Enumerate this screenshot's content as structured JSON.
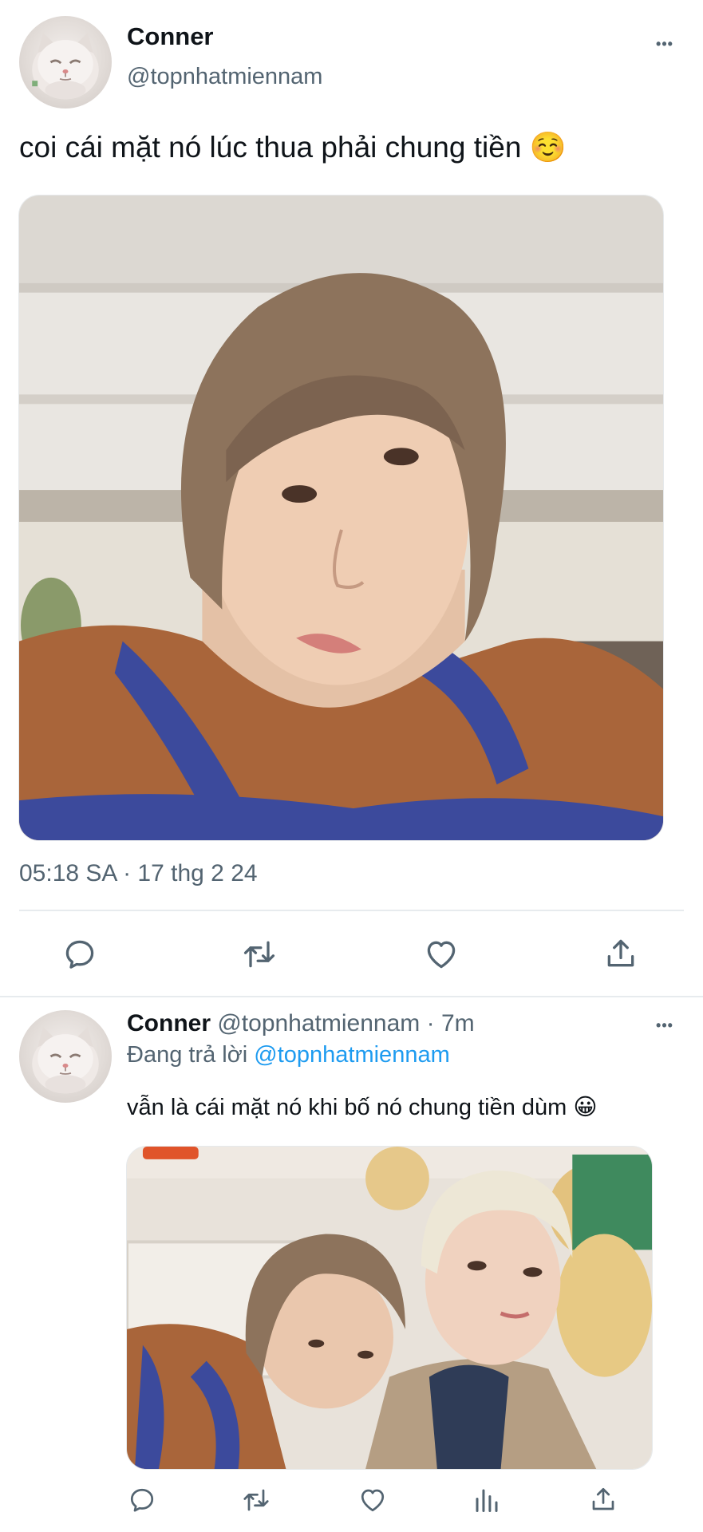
{
  "tweet": {
    "author_name": "Conner",
    "author_handle": "@topnhatmiennam",
    "text": "coi cái mặt nó lúc thua phải chung tiền ☺️",
    "timestamp": "05:18 SA · 17 thg 2 24",
    "more_label": "•••",
    "avatar_icon": "cat-avatar",
    "actions": [
      "reply-icon",
      "retweet-icon",
      "like-icon",
      "share-icon"
    ]
  },
  "reply": {
    "author_name": "Conner",
    "author_handle": "@topnhatmiennam",
    "separator": "·",
    "time": "7m",
    "replying_to_prefix": "Đang trả lời",
    "replying_to_handle": "@topnhatmiennam",
    "text": "vẫn là cái mặt nó khi bố nó chung tiền dùm 😀",
    "more_label": "•••",
    "avatar_icon": "cat-avatar",
    "actions": [
      "reply-icon",
      "retweet-icon",
      "like-icon",
      "views-icon",
      "share-icon"
    ]
  },
  "colors": {
    "text": "#0f1419",
    "secondary": "#536471",
    "link": "#1d9bf0",
    "divider": "#e7ebee"
  }
}
